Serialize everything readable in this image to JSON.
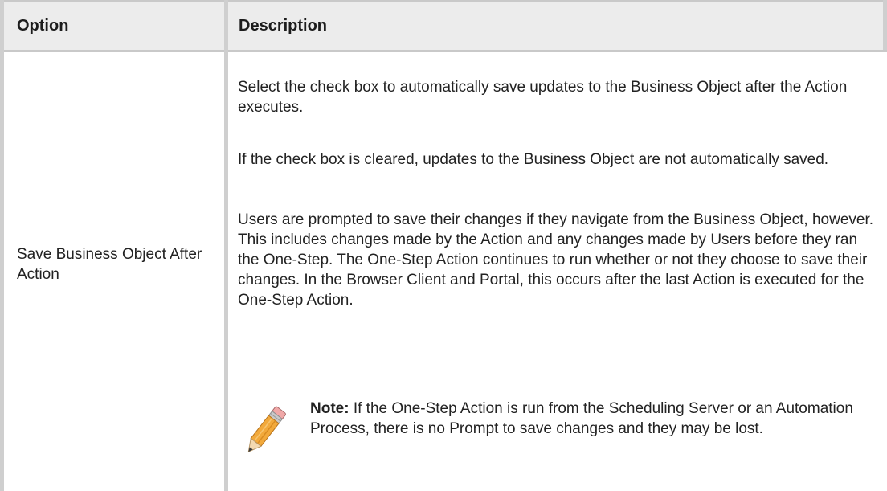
{
  "table": {
    "headers": {
      "option": "Option",
      "description": "Description"
    },
    "rows": [
      {
        "option": "Save Business Object After Action",
        "description": {
          "paragraphs": [
            "Select the check box to automatically save updates to the Business Object after the Action executes.",
            "If the check box is cleared, updates to the Business Object are not automatically saved.",
            "Users are prompted to save their changes if they navigate from the Business Object, however. This includes changes made by the Action and any changes made by Users before they ran the One-Step. The One-Step Action continues to run whether or not they choose to save their changes. In the Browser Client and Portal, this occurs after the last Action is executed for the One-Step Action."
          ],
          "note": {
            "label": "Note:",
            "text": " If the One-Step Action is run from the Scheduling Server or an Automation Process, there is no Prompt to save changes and they may be lost.",
            "icon": "pencil-icon"
          }
        }
      }
    ]
  }
}
